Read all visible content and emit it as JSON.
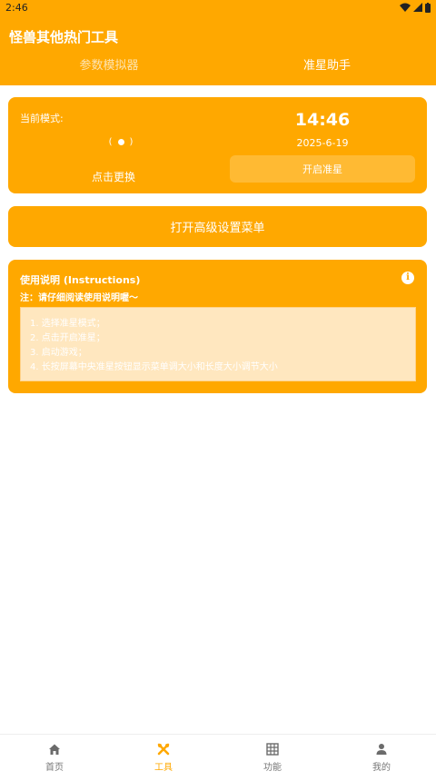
{
  "status_bar": {
    "time": "2:46"
  },
  "app": {
    "title": "怪兽其他热门工具"
  },
  "tabs": [
    {
      "label": "参数模拟器",
      "active": false
    },
    {
      "label": "准星助手",
      "active": true
    }
  ],
  "mode_card": {
    "current_mode_label": "当前模式:",
    "change_label": "点击更换",
    "time": "14:46",
    "date": "2025-6-19",
    "enable_button": "开启准星",
    "indicator_left": "(",
    "indicator_right": ")"
  },
  "advanced_menu": {
    "label": "打开高级设置菜单"
  },
  "instructions": {
    "title": "使用说明 (Instructions)",
    "note": "注：请仔细阅读使用说明喔～",
    "steps": [
      "1. 选择准星模式；",
      "2. 点击开启准星；",
      "3. 启动游戏；",
      "4. 长按屏幕中央准星按钮显示菜单调大小和长度大小调节大小"
    ]
  },
  "bottom_nav": [
    {
      "label": "首页",
      "icon": "home-icon",
      "active": false
    },
    {
      "label": "工具",
      "icon": "tools-icon",
      "active": true
    },
    {
      "label": "功能",
      "icon": "grid-icon",
      "active": false
    },
    {
      "label": "我的",
      "icon": "user-icon",
      "active": false
    }
  ],
  "colors": {
    "accent": "#ffa800",
    "nav_inactive": "#777777"
  }
}
